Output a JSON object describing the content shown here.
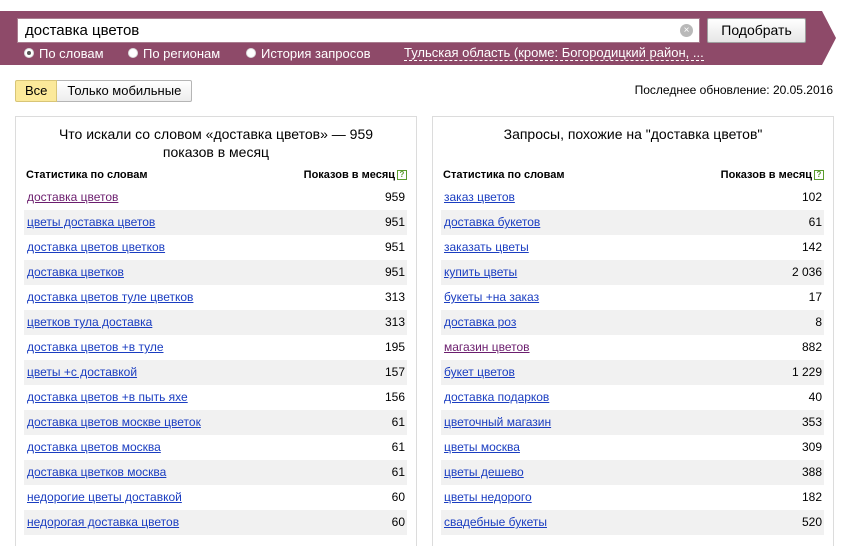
{
  "search": {
    "query": "доставка цветов",
    "button_label": "Подобрать",
    "clear_glyph": "×"
  },
  "modes": [
    {
      "label": "По словам",
      "selected": true
    },
    {
      "label": "По регионам",
      "selected": false
    },
    {
      "label": "История запросов",
      "selected": false
    }
  ],
  "region_link": "Тульская область (кроме: Богородицкий район, ...",
  "tabs": [
    {
      "label": "Все",
      "active": true
    },
    {
      "label": "Только мобильные",
      "active": false
    }
  ],
  "last_update": "Последнее обновление: 20.05.2016",
  "colors": {
    "band": "#8e4a69",
    "link": "#1a3dc1",
    "visited_link": "#6b1d6e",
    "active_tab": "#fbe99a"
  },
  "left_panel": {
    "title": "Что искали со словом «доставка цветов» — 959 показов в месяц",
    "col_words": "Статистика по словам",
    "col_count": "Показов в месяц",
    "help_glyph": "?",
    "rows": [
      {
        "q": "доставка цветов",
        "n": "959",
        "visited": true
      },
      {
        "q": "цветы доставка цветов",
        "n": "951",
        "visited": false
      },
      {
        "q": "доставка цветов цветков",
        "n": "951",
        "visited": false
      },
      {
        "q": "доставка цветков",
        "n": "951",
        "visited": false
      },
      {
        "q": "доставка цветов туле цветков",
        "n": "313",
        "visited": false
      },
      {
        "q": "цветков тула доставка",
        "n": "313",
        "visited": false
      },
      {
        "q": "доставка цветов +в туле",
        "n": "195",
        "visited": false
      },
      {
        "q": "цветы +с доставкой",
        "n": "157",
        "visited": false
      },
      {
        "q": "доставка цветов +в пыть яхе",
        "n": "156",
        "visited": false
      },
      {
        "q": "доставка цветов москве цветок",
        "n": "61",
        "visited": false
      },
      {
        "q": "доставка цветов москва",
        "n": "61",
        "visited": false
      },
      {
        "q": "доставка цветков москва",
        "n": "61",
        "visited": false
      },
      {
        "q": "недорогие цветы доставкой",
        "n": "60",
        "visited": false
      },
      {
        "q": "недорогая доставка цветов",
        "n": "60",
        "visited": false
      }
    ]
  },
  "right_panel": {
    "title": "Запросы, похожие на \"доставка цветов\"",
    "col_words": "Статистика по словам",
    "col_count": "Показов в месяц",
    "help_glyph": "?",
    "rows": [
      {
        "q": "заказ цветов",
        "n": "102",
        "visited": false
      },
      {
        "q": "доставка букетов",
        "n": "61",
        "visited": false
      },
      {
        "q": "заказать цветы",
        "n": "142",
        "visited": false
      },
      {
        "q": "купить цветы",
        "n": "2 036",
        "visited": false
      },
      {
        "q": "букеты +на заказ",
        "n": "17",
        "visited": false
      },
      {
        "q": "доставка роз",
        "n": "8",
        "visited": false
      },
      {
        "q": "магазин цветов",
        "n": "882",
        "visited": true
      },
      {
        "q": "букет цветов",
        "n": "1 229",
        "visited": false
      },
      {
        "q": "доставка подарков",
        "n": "40",
        "visited": false
      },
      {
        "q": "цветочный магазин",
        "n": "353",
        "visited": false
      },
      {
        "q": "цветы москва",
        "n": "309",
        "visited": false
      },
      {
        "q": "цветы дешево",
        "n": "388",
        "visited": false
      },
      {
        "q": "цветы недорого",
        "n": "182",
        "visited": false
      },
      {
        "q": "свадебные букеты",
        "n": "520",
        "visited": false
      }
    ]
  }
}
